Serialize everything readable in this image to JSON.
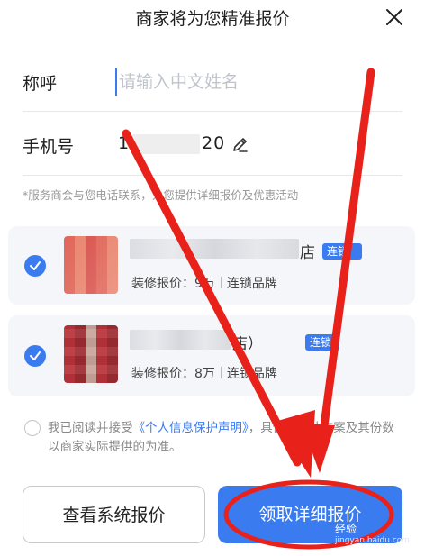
{
  "header": {
    "title": "商家将为您精准报价",
    "close_icon": "close-icon"
  },
  "form": {
    "name_label": "称呼",
    "name_placeholder": "请输入中文姓名",
    "name_value": "",
    "phone_label": "手机号",
    "phone_prefix": "1",
    "phone_suffix": "20",
    "edit_icon": "edit-pencil-icon"
  },
  "note": "*服务商会与您电话联系，为您提供详细报价及优惠活动",
  "merchants": [
    {
      "suffix": "店",
      "badge": "连锁",
      "price_label": "装修报价：",
      "price": "9万",
      "type": "连锁品牌",
      "checked": true
    },
    {
      "suffix": "店）",
      "badge": "连锁",
      "price_label": "装修报价：",
      "price": "8万",
      "type": "连锁品牌",
      "checked": true
    }
  ],
  "agreement": {
    "prefix": "我已阅读并接受",
    "link": "《个人信息保护声明》",
    "suffix": "，具体的设计方案及其份数以商家实际提供的为准。"
  },
  "buttons": {
    "view_system_quote": "查看系统报价",
    "get_detailed_quote": "领取详细报价"
  },
  "watermark": {
    "text": "经验",
    "url": "jingyan.baidu.com"
  },
  "colors": {
    "accent": "#3a7bf0",
    "annotation": "#e8221b"
  }
}
